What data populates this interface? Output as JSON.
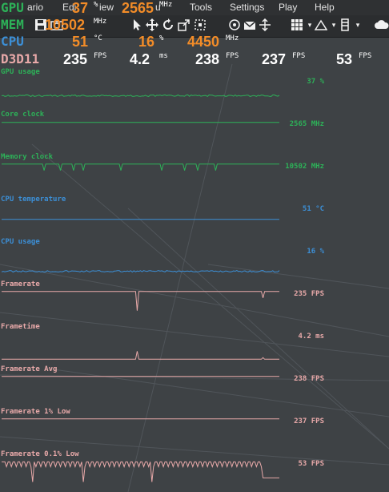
{
  "menu": {
    "items": [
      "ario",
      "Edi",
      "iew",
      "u",
      "Tools",
      "Settings",
      "Play",
      "Help"
    ]
  },
  "osd": {
    "gpu": {
      "label": "GPU",
      "load": "37",
      "load_unit": "%",
      "clock": "2565",
      "clock_unit": "MHz"
    },
    "mem": {
      "label": "MEM",
      "clock": "10502",
      "clock_unit": "MHz"
    },
    "cpu": {
      "label": "CPU",
      "temp": "51",
      "temp_unit": "°C",
      "load": "16",
      "load_unit": "%",
      "clock": "4450",
      "clock_unit": "MHz"
    },
    "d3d": {
      "label": "D3D11",
      "fps1": "235",
      "fps1_unit": "FPS",
      "frametime": "4.2",
      "frametime_unit": "ms",
      "fps2": "238",
      "fps2_unit": "FPS",
      "fps3": "237",
      "fps3_unit": "FPS",
      "fps4": "53",
      "fps4_unit": "FPS"
    }
  },
  "graphs": [
    {
      "label": "GPU usage",
      "value": "37 %",
      "color": "#2db158",
      "kind": "flat-noise",
      "level": 0.37
    },
    {
      "label": "Core clock",
      "value": "2565 MHz",
      "color": "#2db158",
      "kind": "flat",
      "level": 0.95
    },
    {
      "label": "Memory clock",
      "value": "10502 MHz",
      "color": "#2db158",
      "kind": "dips",
      "level": 0.98
    },
    {
      "label": "CPU temperature",
      "value": "51 °C",
      "color": "#3c8fd6",
      "kind": "flat",
      "level": 0.51
    },
    {
      "label": "CPU usage",
      "value": "16 %",
      "color": "#3c8fd6",
      "kind": "flat-noise",
      "level": 0.16
    },
    {
      "label": "Framerate",
      "value": "235 FPS",
      "color": "#e8a9a9",
      "kind": "fps",
      "level": 0.98
    },
    {
      "label": "Frametime",
      "value": "4.2 ms",
      "color": "#e8a9a9",
      "kind": "frametime",
      "level": 0.05
    },
    {
      "label": "Framerate Avg",
      "value": "238 FPS",
      "color": "#e8a9a9",
      "kind": "flat",
      "level": 0.98
    },
    {
      "label": "Framerate 1% Low",
      "value": "237 FPS",
      "color": "#e8a9a9",
      "kind": "flat",
      "level": 0.98
    },
    {
      "label": "Framerate 0.1% Low",
      "value": "53 FPS",
      "color": "#e8a9a9",
      "kind": "lows",
      "level": 0.96
    }
  ],
  "colors": {
    "gpu_label": "#2db158",
    "cpu_label": "#3c8fd6",
    "d3d_label": "#e8a9a9",
    "orange": "#f28c28",
    "white": "#ffffff"
  }
}
